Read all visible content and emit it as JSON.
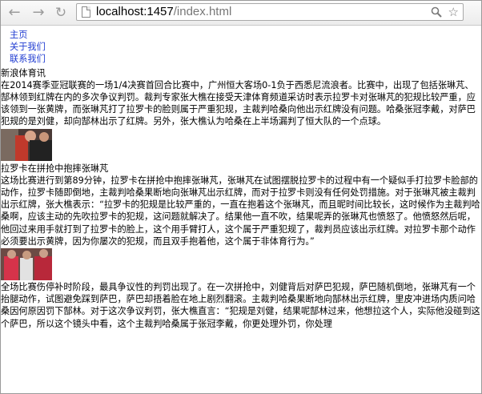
{
  "browser": {
    "url_host": "localhost:1457",
    "url_path": "/index.html",
    "icons": {
      "back": "←",
      "forward": "→",
      "reload": "↻",
      "search": "⚲",
      "star": "☆"
    }
  },
  "nav": {
    "items": [
      {
        "label": "主页"
      },
      {
        "label": "关于我们"
      },
      {
        "label": "联系我们"
      }
    ]
  },
  "sections": [
    {
      "title": "新浪体育讯",
      "body": "在2014赛季亚冠联赛的一场1/4决赛首回合比赛中，广州恒大客场0-1负于西悉尼流浪者。比赛中，出现了包括张琳芃、郜林领到红牌在内的多次争议判罚。裁判专家张大樵在接受天津体育频道采访时表示拉罗卡对张琳芃的犯规比较严重，应该领到一张黄牌，而张琳芃打了拉罗卡的脸则属于严重犯规，主裁判哈桑向他出示红牌没有问题。哈桑张冠李戴，对萨巴犯规的是刘健，却向郜林出示了红牌。另外，张大樵认为哈桑在上半场漏判了恒大队的一个点球。"
    },
    {
      "title": "拉罗卡在拼抢中抱摔张琳芃",
      "body": "这场比赛进行到第89分钟，拉罗卡在拼抢中抱摔张琳芃，张琳芃在试图摆脱拉罗卡的过程中有一个疑似手打拉罗卡脸部的动作，拉罗卡随即倒地，主裁判哈桑果断地向张琳芃出示红牌，而对于拉罗卡则没有任何处罚措施。对于张琳芃被主裁判出示红牌，张大樵表示：“拉罗卡的犯规是比较严重的，一直在抱着这个张琳芃，而且昵时间比较长，这时候作为主裁判哈桑啊，应该主动的先吹拉罗卡的犯规，这问题就解决了。结果他一直不吹，结果呢弄的张琳芃也愤怒了。他愤怒然后呢，他回过来用手就打到了拉罗卡的脸上，这个用手臂打人，这个属于严重犯规了，裁判员应该出示红牌。对拉罗卡那个动作必须要出示黄牌，因为你屡次的犯规，而且双手抱着他，这个属于非体育行为。”"
    },
    {
      "title": "",
      "body": "全场比赛伤停补时阶段，最具争议性的判罚出现了。在一次拼抢中，刘健背后对萨巴犯规，萨巴随机倒地，张琳芃有一个抬腿动作，试图避免踩到萨巴，萨巴却捂着脸在地上剧烈翻滚。主裁判哈桑果断地向郜林出示红牌，里皮冲进场内质问哈桑因何原因罚下郜林。对于这次争议判罚，张大樵直言：“犯规是刘健，结果呢郜林过来，他想拉这个人，实际他没碰到这个萨巴，所以这个镜头中看，这个主裁判哈桑属于张冠李戴，你更处理外罚，你处理"
    }
  ]
}
